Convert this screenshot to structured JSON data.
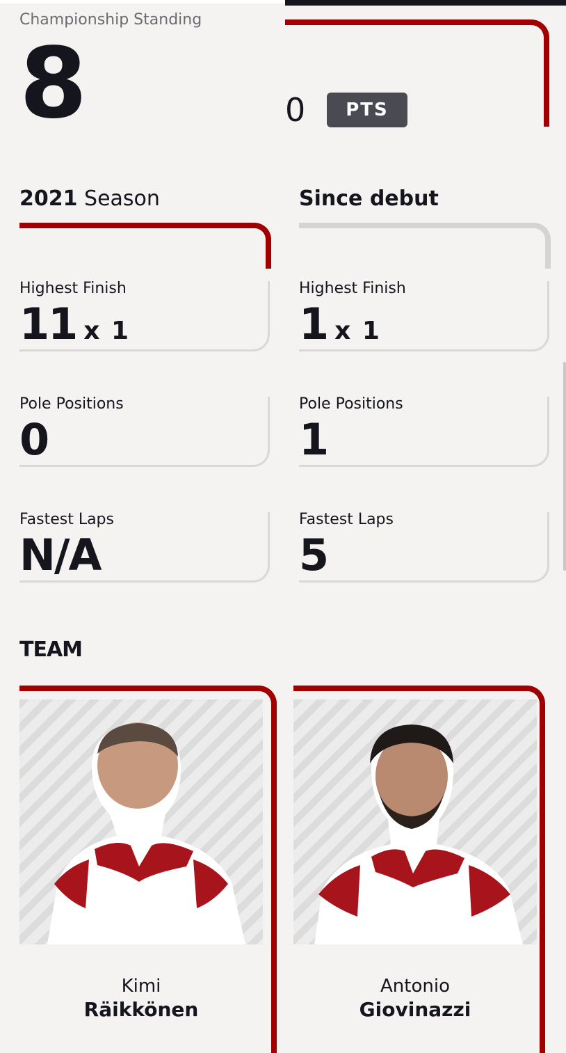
{
  "championship": {
    "label": "Championship Standing",
    "position": "8",
    "points": "0",
    "points_badge": "PTS"
  },
  "season": {
    "year": "2021",
    "word": "Season",
    "stats": [
      {
        "label": "Highest Finish",
        "value": "11",
        "multiplier": "x 1"
      },
      {
        "label": "Pole Positions",
        "value": "0",
        "multiplier": ""
      },
      {
        "label": "Fastest Laps",
        "value": "N/A",
        "multiplier": ""
      }
    ]
  },
  "debut": {
    "title": "Since debut",
    "stats": [
      {
        "label": "Highest Finish",
        "value": "1",
        "multiplier": "x 1"
      },
      {
        "label": "Pole Positions",
        "value": "1",
        "multiplier": ""
      },
      {
        "label": "Fastest Laps",
        "value": "5",
        "multiplier": ""
      }
    ]
  },
  "team": {
    "heading": "TEAM",
    "drivers": [
      {
        "first": "Kimi",
        "last": "Räikkönen"
      },
      {
        "first": "Antonio",
        "last": "Giovinazzi"
      }
    ]
  },
  "colors": {
    "accent": "#a00000",
    "muted": "#d4d4d4",
    "badge": "#4a4a52",
    "background": "#f4f3f1"
  }
}
